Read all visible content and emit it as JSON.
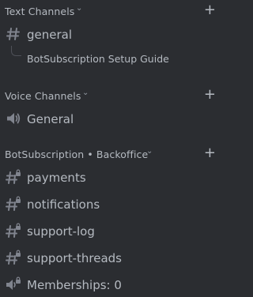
{
  "categories": {
    "text": {
      "label": "Text Channels",
      "chevron": "⌄",
      "add": "+"
    },
    "voice": {
      "label": "Voice Channels",
      "chevron": "⌄",
      "add": "+"
    },
    "backoffice": {
      "label": "BotSubscription • Backoffice",
      "chevron": "⌄",
      "add": "+"
    }
  },
  "text_channels": [
    {
      "name": "general",
      "icon": "hash-icon"
    }
  ],
  "threads": [
    {
      "name": "BotSubscription Setup Guide"
    }
  ],
  "voice_channels": [
    {
      "name": "General",
      "icon": "speaker-icon"
    }
  ],
  "backoffice_channels": [
    {
      "name": "payments",
      "icon": "locked-hash-icon"
    },
    {
      "name": "notifications",
      "icon": "locked-hash-icon"
    },
    {
      "name": "support-log",
      "icon": "locked-hash-icon"
    },
    {
      "name": "support-threads",
      "icon": "locked-hash-icon"
    },
    {
      "name": "Memberships: 0",
      "icon": "locked-speaker-icon"
    }
  ],
  "colors": {
    "background": "#2b2d31",
    "text": "#b5bac1",
    "muted": "#949ba4"
  }
}
